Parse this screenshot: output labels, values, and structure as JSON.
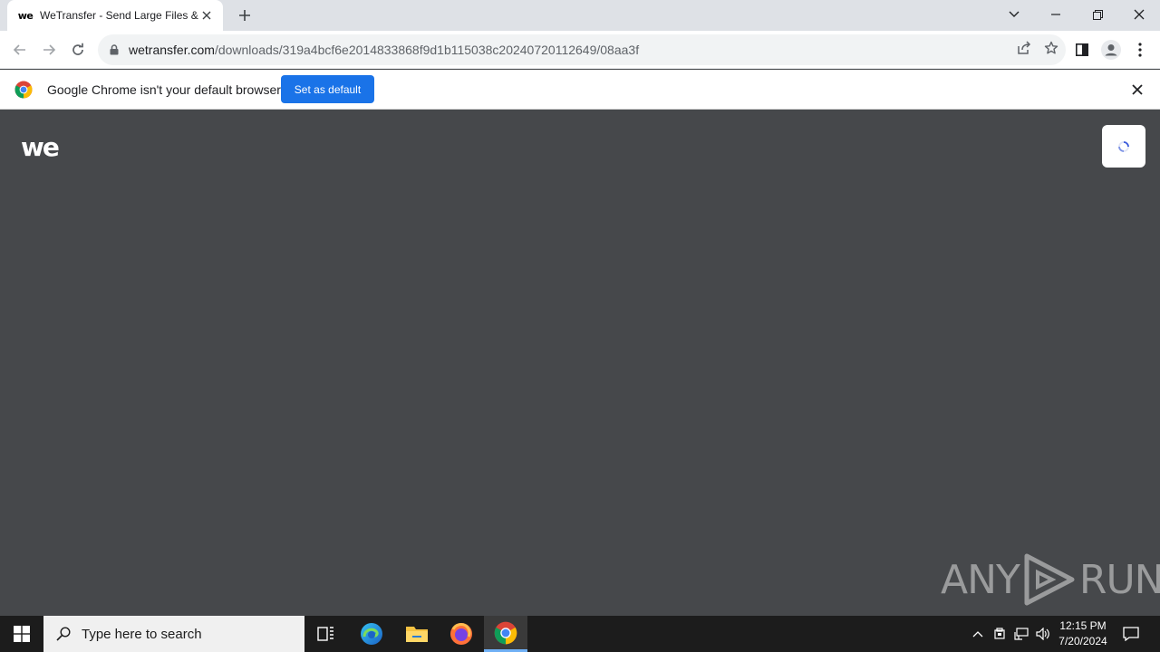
{
  "browser": {
    "tab": {
      "title": "WeTransfer - Send Large Files &",
      "favicon_text": "we"
    },
    "new_tab_label": "+",
    "address": {
      "host": "wetransfer.com",
      "path": "/downloads/319a4bcf6e2014833868f9d1b115038c20240720112649/08aa3f"
    },
    "window_controls": [
      "chevron-down-icon",
      "minimize-icon",
      "restore-icon",
      "close-icon"
    ],
    "toolbar_icons": [
      "back-icon",
      "forward-icon",
      "reload-icon",
      "share-icon",
      "bookmark-star-icon",
      "side-panel-icon",
      "profile-icon",
      "menu-icon"
    ]
  },
  "infobar": {
    "message": "Google Chrome isn't your default browser",
    "button_label": "Set as default"
  },
  "page": {
    "logo_text": "we",
    "loading": true
  },
  "watermark": {
    "left": "ANY",
    "right": "RUN"
  },
  "taskbar": {
    "search_placeholder": "Type here to search",
    "apps": [
      "task-view-icon",
      "edge-icon",
      "file-explorer-icon",
      "firefox-icon",
      "chrome-icon"
    ],
    "active_app": "chrome-icon",
    "clock": {
      "time": "12:15 PM",
      "date": "7/20/2024"
    }
  },
  "colors": {
    "page_bg": "#46484b",
    "accent": "#1a73e8",
    "taskbar_bg": "#1c1c1c"
  }
}
